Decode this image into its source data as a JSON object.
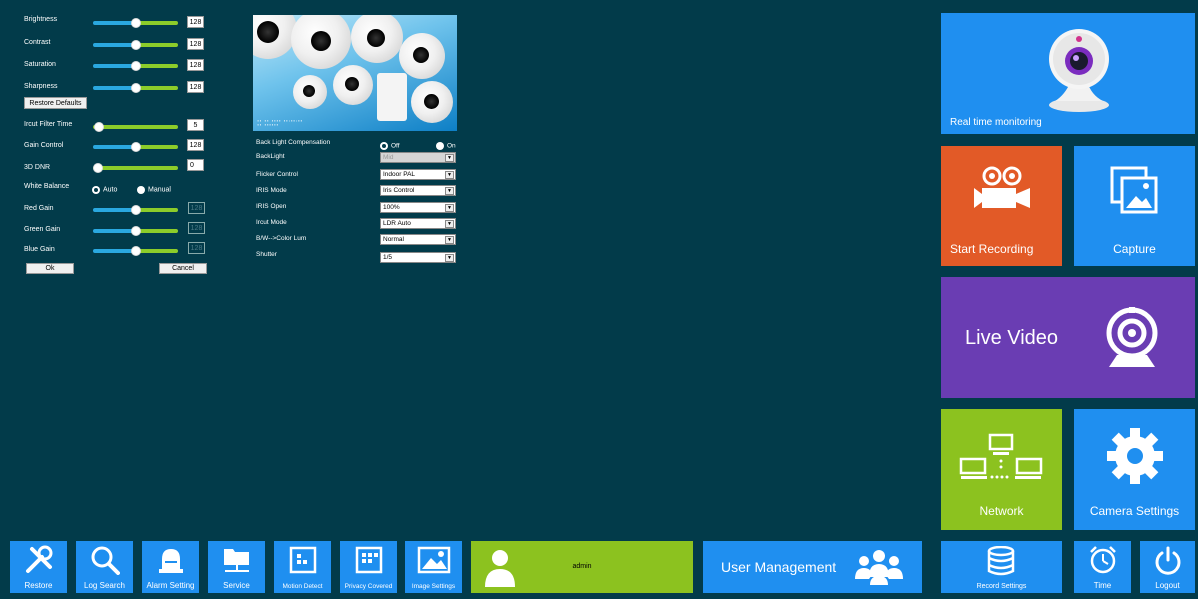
{
  "image_settings": {
    "brightness": {
      "label": "Brightness",
      "value": "128",
      "level": 0.5
    },
    "contrast": {
      "label": "Contrast",
      "value": "128",
      "level": 0.5
    },
    "saturation": {
      "label": "Saturation",
      "value": "128",
      "level": 0.5
    },
    "sharpness": {
      "label": "Sharpness",
      "value": "128",
      "level": 0.5
    },
    "restore_defaults": "Restore Defaults",
    "ircut_filter_time": {
      "label": "Ircut Filter Time",
      "value": "5",
      "level": 0.05
    },
    "gain_control": {
      "label": "Gain Control",
      "value": "128",
      "level": 0.5
    },
    "dnr": {
      "label": "3D DNR",
      "value": "0",
      "level": 0.02
    },
    "white_balance": {
      "label": "White Balance",
      "auto": "Auto",
      "manual": "Manual",
      "selected": "Auto"
    },
    "red_gain": {
      "label": "Red Gain",
      "value": "128",
      "level": 0.5
    },
    "green_gain": {
      "label": "Green Gain",
      "value": "128",
      "level": 0.5
    },
    "blue_gain": {
      "label": "Blue Gain",
      "value": "128",
      "level": 0.5
    },
    "ok": "Ok",
    "cancel": "Cancel"
  },
  "camera_settings": {
    "blc": {
      "label": "Back Light Compensation",
      "off": "Off",
      "on": "On",
      "selected": "Off"
    },
    "backlight": {
      "label": "BackLight",
      "value": "Mid"
    },
    "flicker": {
      "label": "Flicker Control",
      "value": "Indoor PAL"
    },
    "iris_mode": {
      "label": "IRIS Mode",
      "value": "Iris Control"
    },
    "iris_open": {
      "label": "IRIS Open",
      "value": "100%"
    },
    "ircut_mode": {
      "label": "Ircut Mode",
      "value": "LDR Auto"
    },
    "bw_color": {
      "label": "B/W-->Color Lum",
      "value": "Normal"
    },
    "shutter": {
      "label": "Shutter",
      "value": "1/5"
    }
  },
  "tiles": {
    "real_time": "Real time monitoring",
    "start_recording": "Start Recording",
    "capture": "Capture",
    "live_video": "Live Video",
    "network": "Network",
    "camera_settings": "Camera Settings"
  },
  "bottom": {
    "restore": "Restore",
    "log_search": "Log Search",
    "alarm_setting": "Alarm Setting",
    "service": "Service",
    "motion_detect": "Motion Detect",
    "privacy_covered": "Privacy Covered",
    "image_settings": "Image Settings",
    "user": "admin",
    "user_management": "User Management",
    "record_settings": "Record Settings",
    "time": "Time",
    "logout": "Logout"
  },
  "colors": {
    "background": "#023b4a",
    "blue": "#1f8ff0",
    "orange": "#e25a27",
    "purple": "#6a3db3",
    "green": "#8cc21f"
  }
}
